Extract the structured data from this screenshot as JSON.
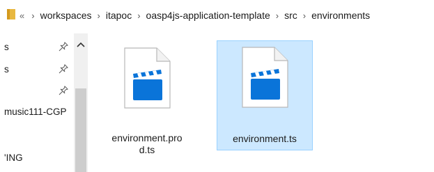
{
  "address_bar": {
    "overflow": "«",
    "breadcrumbs": [
      "workspaces",
      "itapoc",
      "oasp4js-application-template",
      "src",
      "environments"
    ]
  },
  "nav_pane": {
    "items": [
      {
        "label": "s",
        "pinned": true
      },
      {
        "label": "s",
        "pinned": true
      },
      {
        "label": "",
        "pinned": true
      },
      {
        "label": "music111-CGP",
        "pinned": false
      },
      {
        "label": "'ING",
        "pinned": false
      }
    ]
  },
  "files": [
    {
      "name": "environment.pro\nd.ts",
      "line1": "environment.pro",
      "line2": "d.ts",
      "selected": false,
      "icon": "video-clapper-file-icon"
    },
    {
      "name": "environment.ts",
      "line1": "environment.ts",
      "line2": "",
      "selected": true,
      "icon": "video-clapper-file-icon"
    }
  ],
  "colors": {
    "selection_bg": "#cce8ff",
    "selection_border": "#99d1ff",
    "clapper_blue": "#0a74d9"
  }
}
